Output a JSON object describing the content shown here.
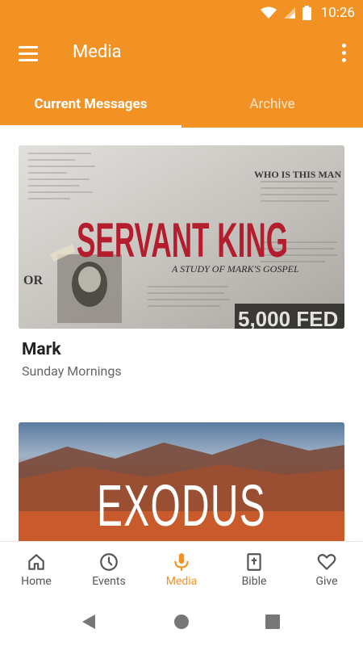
{
  "status_bar": {
    "time": "10:26"
  },
  "app_bar": {
    "title": "Media"
  },
  "tabs": [
    {
      "label": "Current Messages",
      "active": true
    },
    {
      "label": "Archive",
      "active": false
    }
  ],
  "series": [
    {
      "title": "Mark",
      "subtitle": "Sunday Mornings",
      "artwork": {
        "title_text": "SERVANT KING",
        "tagline": "A STUDY OF MARK'S GOSPEL",
        "headline": "WHO IS THIS MAN",
        "corner_text": "5,000 FED",
        "edge_text": "OR"
      }
    },
    {
      "title": "",
      "subtitle": "",
      "artwork": {
        "title_text": "EXODUS"
      }
    }
  ],
  "bottom_nav": [
    {
      "label": "Home",
      "icon": "home-icon",
      "active": false
    },
    {
      "label": "Events",
      "icon": "clock-icon",
      "active": false
    },
    {
      "label": "Media",
      "icon": "microphone-icon",
      "active": true
    },
    {
      "label": "Bible",
      "icon": "bible-icon",
      "active": false
    },
    {
      "label": "Give",
      "icon": "heart-icon",
      "active": false
    }
  ],
  "colors": {
    "accent": "#f29224",
    "nav_inactive": "#555555"
  }
}
